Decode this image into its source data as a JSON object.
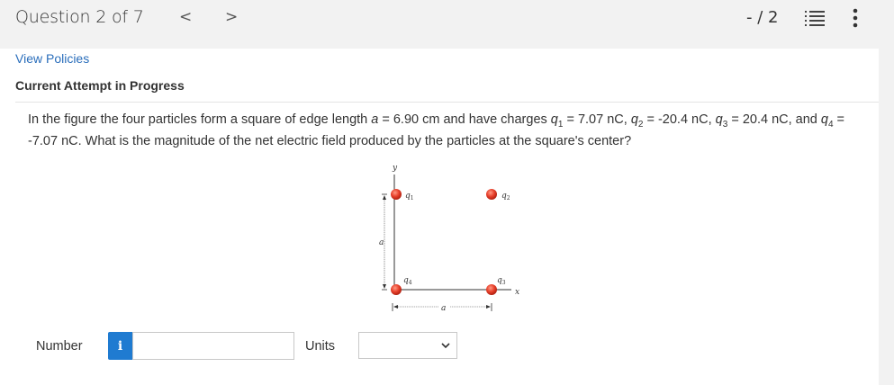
{
  "header": {
    "question_label": "Question 2 of 7",
    "prev_glyph": "<",
    "next_glyph": ">",
    "score": "- / 2",
    "list_icon": "list-icon",
    "more_icon": "more-vertical-icon"
  },
  "links": {
    "view_policies": "View Policies"
  },
  "attempt": {
    "status": "Current Attempt in Progress"
  },
  "question": {
    "p1": "In the figure the four particles form a square of edge length ",
    "a_var": "a",
    "p2": " = 6.90 cm and have charges ",
    "q": "q",
    "s1": "1",
    "p3": " = 7.07 nC, ",
    "s2": "2",
    "p4": " = -20.4 nC, ",
    "s3": "3",
    "p5": " = 20.4 nC, and ",
    "s4": "4",
    "p6": " = -7.07 nC. What is the magnitude of the net electric field produced by the particles at the square's center?"
  },
  "figure": {
    "y_axis": "y",
    "x_axis": "x",
    "a_vertical": "a",
    "a_horizontal": "a",
    "q": "q",
    "s1": "1",
    "s2": "2",
    "s3": "3",
    "s4": "4",
    "particle_color": "#e8412c"
  },
  "answer": {
    "number_label": "Number",
    "info_glyph": "i",
    "number_value": "",
    "units_label": "Units",
    "units_value": ""
  },
  "colors": {
    "accent": "#1f7bd1",
    "link": "#2a6ebb"
  }
}
